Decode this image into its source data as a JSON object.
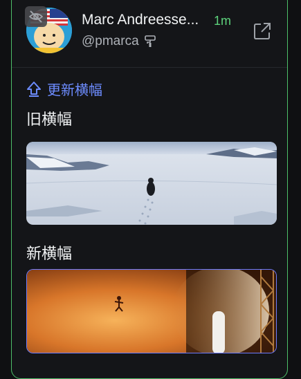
{
  "profile": {
    "name": "Marc Andreesse...",
    "time": "1m",
    "handle": "@pmarca"
  },
  "update_label": "更新横幅",
  "old_banner_label": "旧横幅",
  "new_banner_label": "新横幅",
  "colors": {
    "accent_green": "#4ec06a",
    "time_green": "#5dd37c",
    "link_blue": "#6d8cff",
    "new_banner_border": "#6d7cff"
  },
  "icons": {
    "hide": "eye-slash-icon",
    "paint_roller": "paint-roller-icon",
    "external_link": "external-link-icon",
    "update": "arrow-up-outline-icon"
  }
}
